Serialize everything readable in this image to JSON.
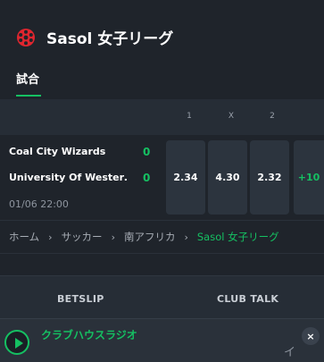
{
  "header": {
    "league_icon": "football-icon",
    "title": "Sasol 女子リーグ",
    "tab_label": "試合",
    "accent": "#15c062"
  },
  "odds_columns": [
    "1",
    "X",
    "2"
  ],
  "match": {
    "home_team": "Coal City Wizards",
    "home_score": "0",
    "away_team": "University Of Wester…",
    "away_score": "0",
    "datetime": "01/06 22:00",
    "odds": {
      "home": "2.34",
      "draw": "4.30",
      "away": "2.32"
    },
    "more_markets": "+10"
  },
  "breadcrumb": {
    "items": [
      "ホーム",
      "サッカー",
      "南アフリカ",
      "Sasol 女子リーグ"
    ],
    "separator": "›"
  },
  "footer_tabs": {
    "betslip": "BETSLIP",
    "club_talk": "CLUB TALK"
  },
  "player": {
    "play_icon": "play-icon",
    "station": "クラブハウスラジオ",
    "marquee_text": "イ",
    "close_icon": "close-icon",
    "close_label": "×"
  }
}
